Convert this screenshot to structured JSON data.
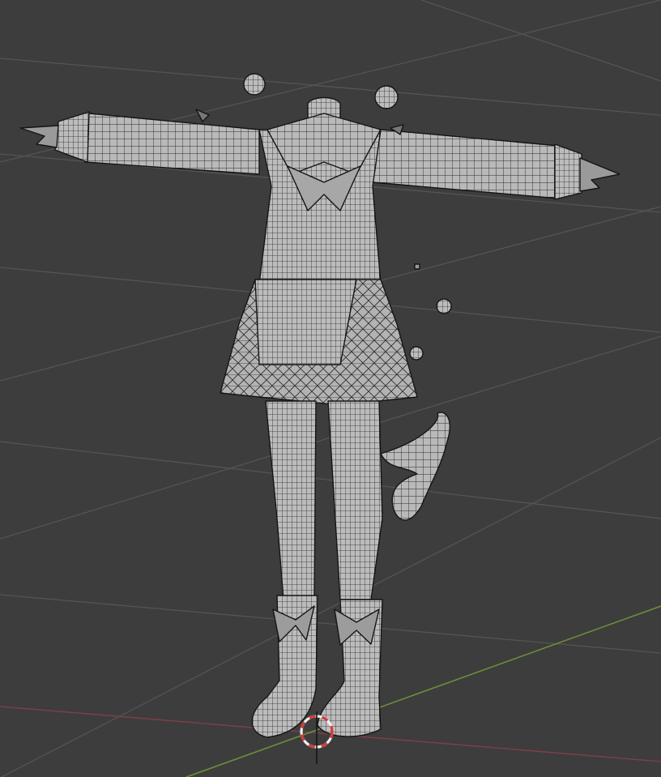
{
  "viewport": {
    "background": "#3d3d3d",
    "grid_color": "#555555",
    "x_axis_color": "#7a3e46",
    "y_axis_color": "#6a8f3a"
  },
  "model": {
    "fill": "#b7b7b7",
    "shade": "#8f8f8f",
    "wire": "#1a1a1a"
  },
  "cursor_3d": {
    "ring_red": "#d63a3a",
    "ring_white": "#f0f0f0"
  },
  "icons": {
    "origin": "3d-cursor-icon"
  }
}
